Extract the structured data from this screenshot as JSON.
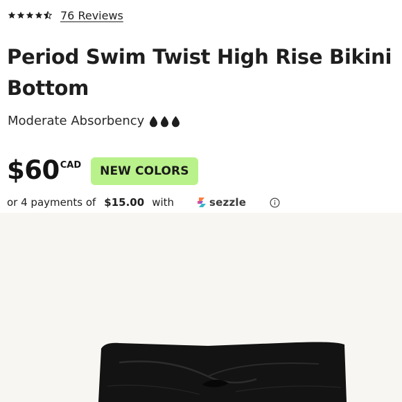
{
  "rating": {
    "stars_value": 4.5,
    "stars_max": 5,
    "icon": "star-icon",
    "reviews_link": "76 Reviews"
  },
  "product": {
    "title": "Period Swim Twist High Rise Bikini Bottom",
    "absorbency_label": "Moderate Absorbency",
    "absorbency_drops": 3,
    "drop_icon": "drop-icon",
    "price": "$60",
    "currency": "CAD",
    "badge": "NEW COLORS"
  },
  "installments": {
    "prefix": "or 4 payments of",
    "amount": "$15.00",
    "with": "with",
    "provider": "sezzle",
    "info_icon": "info-icon"
  },
  "colors": {
    "badge_bg": "#b9f28a",
    "text": "#1e1e1e",
    "image_bg": "#f7f6f2",
    "garment": "#131313"
  }
}
